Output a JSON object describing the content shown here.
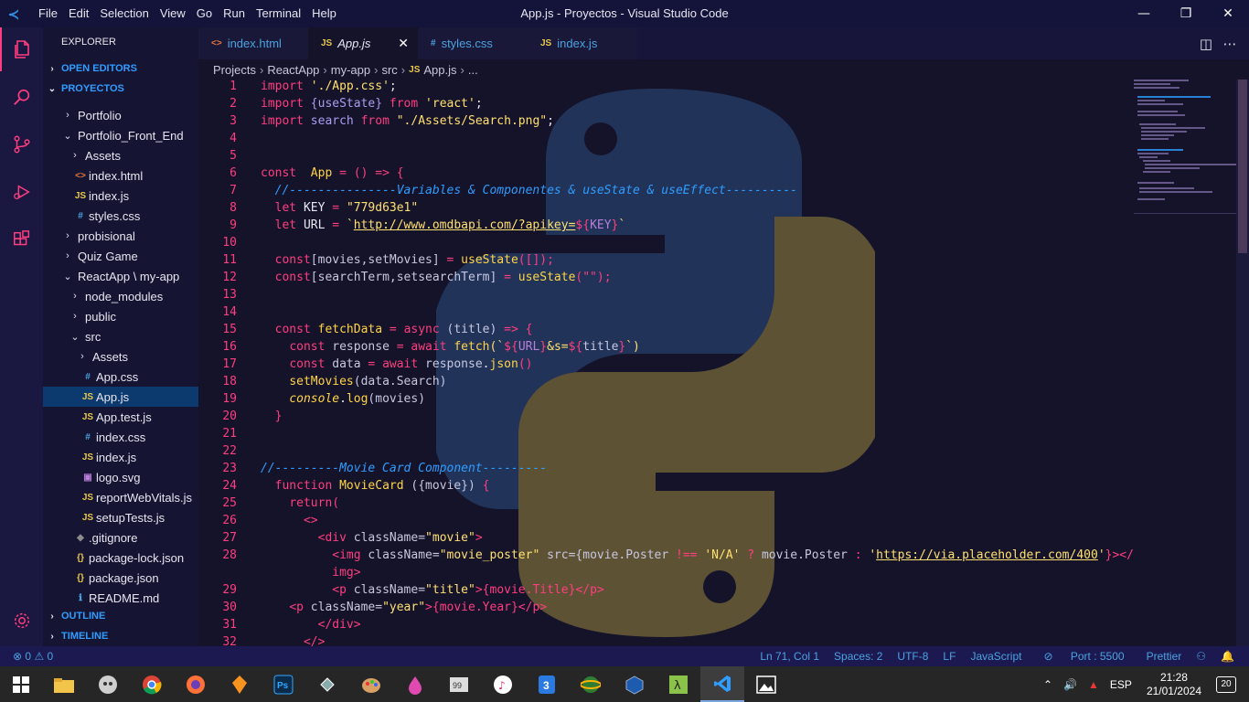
{
  "titlebar": {
    "menu": [
      "File",
      "Edit",
      "Selection",
      "View",
      "Go",
      "Run",
      "Terminal",
      "Help"
    ],
    "title": "App.js - Proyectos - Visual Studio Code"
  },
  "sidebar": {
    "title": "EXPLORER",
    "open_editors": "OPEN EDITORS",
    "project": "PROYECTOS",
    "outline": "OUTLINE",
    "timeline": "TIMELINE",
    "items": [
      {
        "label": "Portfolio",
        "type": "folder",
        "indent": 0
      },
      {
        "label": "Portfolio_Front_End",
        "type": "folder-open",
        "indent": 0
      },
      {
        "label": "Assets",
        "type": "folder",
        "indent": 1
      },
      {
        "label": "index.html",
        "type": "html",
        "indent": 1
      },
      {
        "label": "index.js",
        "type": "js",
        "indent": 1
      },
      {
        "label": "styles.css",
        "type": "css",
        "indent": 1
      },
      {
        "label": "probisional",
        "type": "folder",
        "indent": 0
      },
      {
        "label": "Quiz Game",
        "type": "folder",
        "indent": 0
      },
      {
        "label": "ReactApp \\ my-app",
        "type": "folder-open",
        "indent": 0
      },
      {
        "label": "node_modules",
        "type": "folder",
        "indent": 1
      },
      {
        "label": "public",
        "type": "folder",
        "indent": 1
      },
      {
        "label": "src",
        "type": "folder-open",
        "indent": 1
      },
      {
        "label": "Assets",
        "type": "folder",
        "indent": 2
      },
      {
        "label": "App.css",
        "type": "css",
        "indent": 2
      },
      {
        "label": "App.js",
        "type": "js",
        "indent": 2,
        "selected": true
      },
      {
        "label": "App.test.js",
        "type": "js",
        "indent": 2
      },
      {
        "label": "index.css",
        "type": "css",
        "indent": 2
      },
      {
        "label": "index.js",
        "type": "js",
        "indent": 2
      },
      {
        "label": "logo.svg",
        "type": "svg",
        "indent": 2
      },
      {
        "label": "reportWebVitals.js",
        "type": "js",
        "indent": 2
      },
      {
        "label": "setupTests.js",
        "type": "js",
        "indent": 2
      },
      {
        "label": ".gitignore",
        "type": "git",
        "indent": 1
      },
      {
        "label": "package-lock.json",
        "type": "json",
        "indent": 1
      },
      {
        "label": "package.json",
        "type": "json",
        "indent": 1
      },
      {
        "label": "README.md",
        "type": "info",
        "indent": 1
      }
    ]
  },
  "tabs": [
    {
      "label": "index.html",
      "icon": "<>",
      "type": "html"
    },
    {
      "label": "App.js",
      "icon": "JS",
      "type": "js",
      "active": true
    },
    {
      "label": "styles.css",
      "icon": "#",
      "type": "css"
    },
    {
      "label": "index.js",
      "icon": "JS",
      "type": "js"
    }
  ],
  "breadcrumb": [
    "Projects",
    "ReactApp",
    "my-app",
    "src",
    "App.js",
    "..."
  ],
  "statusbar": {
    "errors": "0",
    "warnings": "0",
    "position": "Ln 71, Col 1",
    "spaces": "Spaces: 2",
    "encoding": "UTF-8",
    "eol": "LF",
    "language": "JavaScript",
    "port": "Port : 5500",
    "prettier": "Prettier"
  },
  "taskbar": {
    "lang": "ESP",
    "time": "21:28",
    "date": "21/01/2024",
    "notifications": "20"
  },
  "code_lines": [
    "1",
    "2",
    "3",
    "4",
    "5",
    "6",
    "7",
    "8",
    "9",
    "10",
    "11",
    "12",
    "13",
    "14",
    "15",
    "16",
    "17",
    "18",
    "19",
    "20",
    "21",
    "22",
    "23",
    "24",
    "25",
    "26",
    "27",
    "28",
    "",
    "29",
    "30",
    "31",
    "32"
  ],
  "code": {
    "l1": [
      "import",
      "'./App.css'",
      ";"
    ],
    "l2": [
      "import",
      "{useState}",
      "from",
      "'react'",
      ";"
    ],
    "l3": [
      "import",
      "search",
      "from",
      "\"./Assets/Search.png\"",
      ";"
    ],
    "l6": [
      "const",
      "App",
      "=",
      "() =>",
      "{"
    ],
    "l7": "//---------------Variables & Componentes & useState & useEffect----------",
    "l8": [
      "let",
      "KEY",
      "=",
      "\"779d63e1\""
    ],
    "l9": [
      "let",
      "URL",
      "=",
      "`",
      "http://www.omdbapi.com/?apikey=",
      "${",
      "KEY",
      "}",
      "`"
    ],
    "l11": [
      "const",
      "[movies,setMovies]",
      "=",
      "useState",
      "([]);"
    ],
    "l12": [
      "const",
      "[searchTerm,setsearchTerm]",
      "=",
      "useState",
      "(\"\");"
    ],
    "l15": [
      "const",
      "fetchData",
      "=",
      "async",
      "(title)",
      "=>",
      "{"
    ],
    "l16": [
      "const",
      "response",
      "=",
      "await",
      "fetch",
      "(`",
      "${",
      "URL",
      "}",
      "&s=",
      "${",
      "title",
      "}",
      "`)"
    ],
    "l17": [
      "const",
      "data",
      "=",
      "await",
      "response",
      ".",
      "json",
      "()"
    ],
    "l18": [
      "setMovies",
      "(data.Search)"
    ],
    "l19": [
      "console",
      ".",
      "log",
      "(movies)"
    ],
    "l20": "}",
    "l23": "//---------Movie Card Component---------",
    "l24": [
      "function",
      "MovieCard",
      "({movie})",
      "{"
    ],
    "l25": [
      "return",
      "("
    ],
    "l26": "<>",
    "l27": [
      "<div",
      "className=",
      "\"movie\"",
      ">"
    ],
    "l28a": [
      "<img",
      "className=",
      "\"movie_poster\"",
      "src=",
      "{movie.Poster",
      "!==",
      "'N/A'",
      "?",
      "movie.Poster",
      ":",
      "'",
      "https://via.placeholder.com/400",
      "'",
      "}></"
    ],
    "l28b": "img>",
    "l29": [
      "<p",
      "className=",
      "\"title\"",
      ">{movie.Title}</p>"
    ],
    "l30": [
      "<p",
      "className=",
      "\"year\"",
      ">{movie.Year}</p>"
    ],
    "l31": "</div>",
    "l32": "</>"
  },
  "colors": {
    "keyword": "#ff3e7f",
    "string": "#ffe070",
    "comment": "#2f9dff",
    "accent": "#ff3e7f",
    "statusbar": "#1c1850"
  }
}
